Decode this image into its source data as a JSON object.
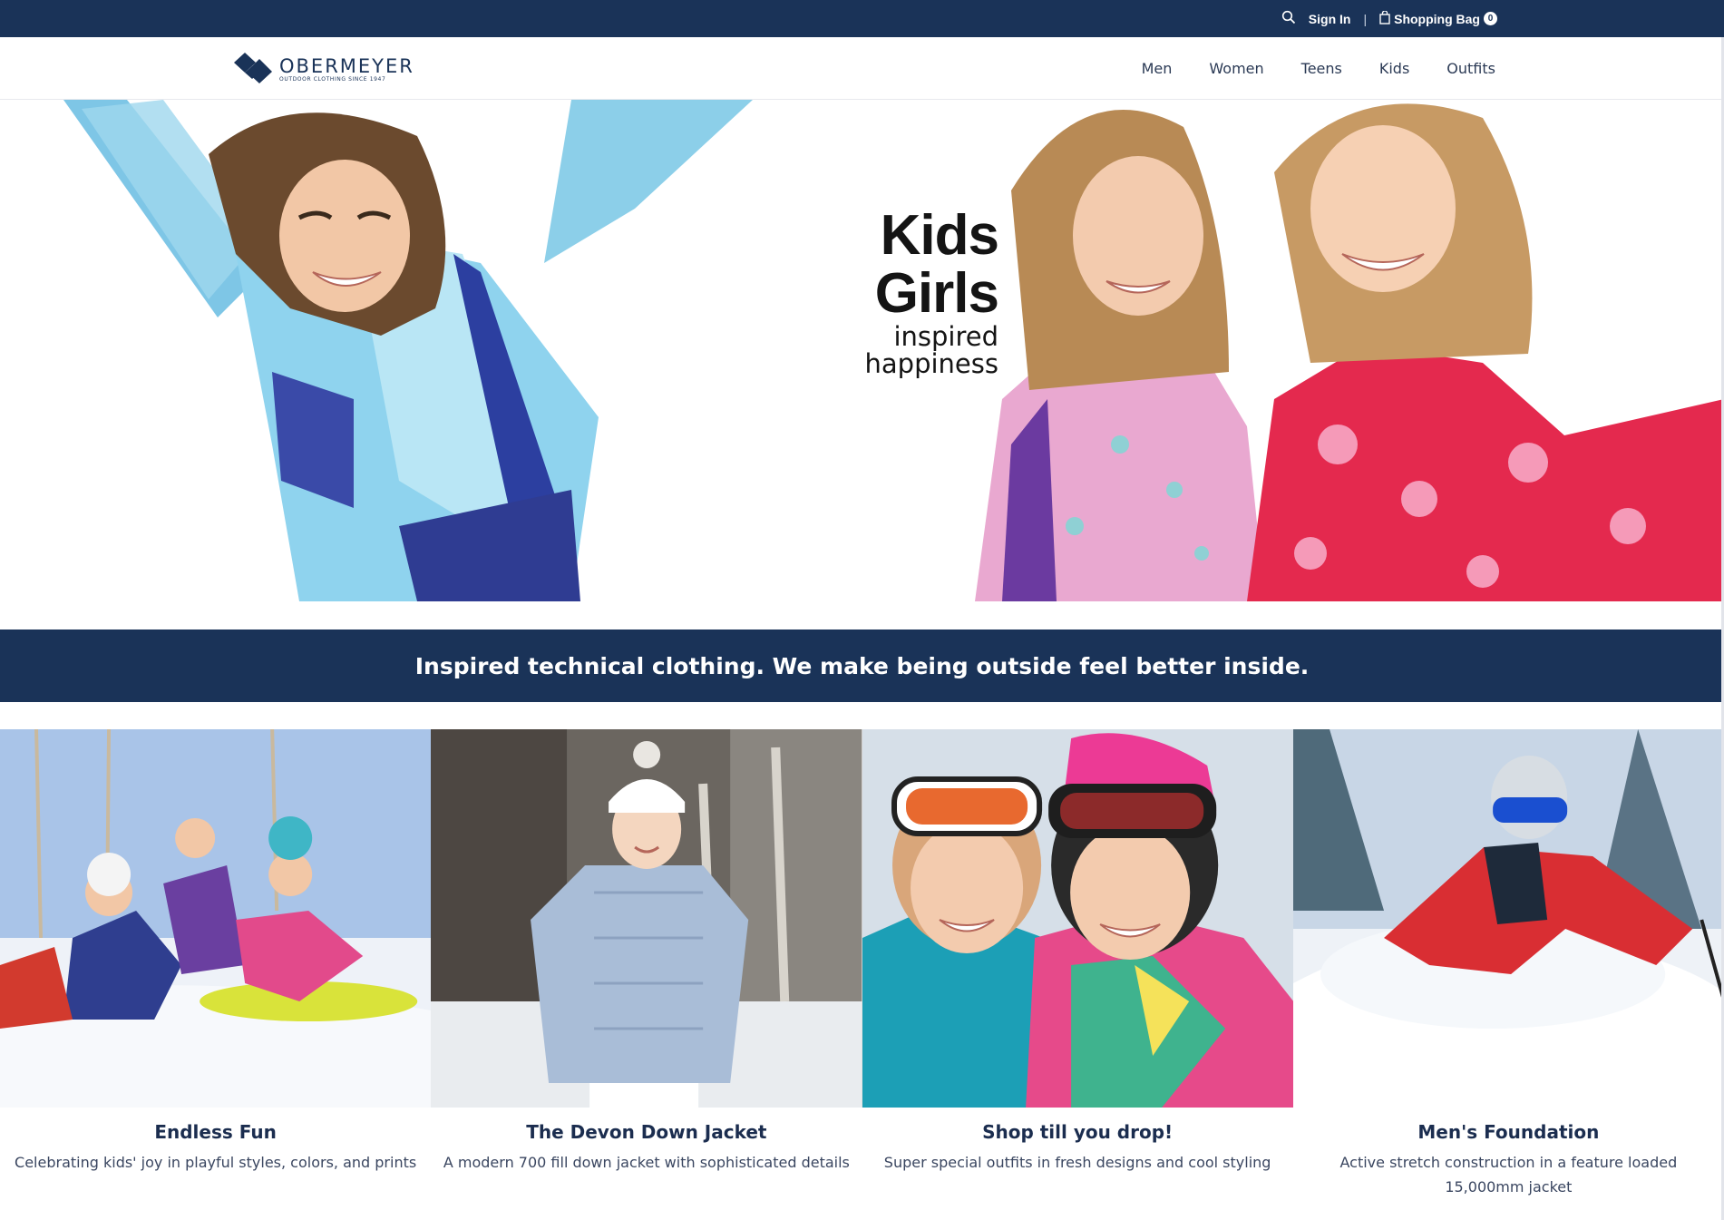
{
  "topbar": {
    "sign_in": "Sign In",
    "separator": "|",
    "shopping_bag": "Shopping Bag",
    "bag_count": "0",
    "search_icon": "search-icon",
    "bag_icon": "bag-icon"
  },
  "header": {
    "logo_name": "OBERMEYER",
    "logo_tagline": "OUTDOOR CLOTHING SINCE 1947",
    "nav": [
      {
        "label": "Men"
      },
      {
        "label": "Women"
      },
      {
        "label": "Teens"
      },
      {
        "label": "Kids"
      },
      {
        "label": "Outfits"
      }
    ]
  },
  "hero": {
    "title": "Kids Girls",
    "subtitle": "inspired happiness"
  },
  "banner": {
    "text": "Inspired technical clothing. We make being outside feel better inside."
  },
  "tiles": [
    {
      "title": "Endless Fun",
      "desc": "Celebrating kids' joy in playful styles, colors, and prints"
    },
    {
      "title": "The Devon Down Jacket",
      "desc": "A modern 700 fill down jacket with sophisticated details"
    },
    {
      "title": "Shop till you drop!",
      "desc": "Super special outfits in fresh designs and cool styling"
    },
    {
      "title": "Men's Foundation",
      "desc": "Active stretch construction in a feature loaded 15,000mm jacket"
    }
  ],
  "colors": {
    "navy": "#1a3358",
    "text": "#1b2d4f",
    "white": "#ffffff"
  }
}
